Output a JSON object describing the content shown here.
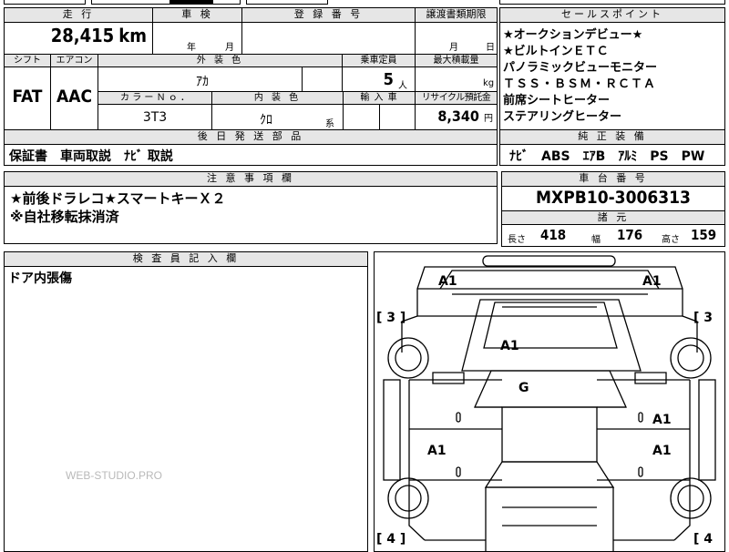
{
  "header": {
    "mileage_label": "走 行",
    "inspection_label": "車 検",
    "registration_label": "登 録 番 号",
    "transfer_label": "譲渡書類期限",
    "selling_points_label": "セールスポイント"
  },
  "mileage": {
    "value": "28,415",
    "unit": "km"
  },
  "inspection": {
    "year_unit": "年",
    "month_unit": "月"
  },
  "transfer": {
    "month_unit": "月",
    "day_unit": "日"
  },
  "shift": {
    "label": "シフト",
    "value": "FAT"
  },
  "aircon": {
    "label": "エアコン",
    "value": "AAC"
  },
  "exterior_color": {
    "label": "外 装 色",
    "value": "ｱｶ"
  },
  "capacity": {
    "label": "乗車定員",
    "value": "5",
    "unit": "人"
  },
  "max_load": {
    "label": "最大積載量",
    "unit": "kg"
  },
  "color_no": {
    "label": "カ ラ ー Ｎ ｏ ．",
    "value": "3T3"
  },
  "interior_color": {
    "label": "内 装 色",
    "value": "ｸﾛ",
    "suffix": "系"
  },
  "import": {
    "label": "輸 入 車"
  },
  "recycle": {
    "label": "リサイクル預託金",
    "value": "8,340",
    "unit": "円"
  },
  "selling_points": [
    "★オークションデビュー★",
    "★ビルトインＥＴＣ",
    "パノラミックビューモニター",
    "ＴＳＳ・ＢＳＭ・ＲＣＴＡ",
    "前席シートヒーター",
    "ステアリングヒーター"
  ],
  "later_parts": {
    "label": "後 日 発 送 部 品",
    "value": "保証書　車両取説　ﾅﾋﾞ 取説"
  },
  "genuine_equipment": {
    "label": "純 正 装 備",
    "value": "ﾅﾋﾞ　ABS　ｴｱB　ｱﾙﾐ　PS　PW"
  },
  "notes": {
    "label": "注 意 事 項 欄",
    "lines": [
      "★前後ドラレコ★スマートキーＸ２",
      "※自社移転抹消済"
    ]
  },
  "chassis": {
    "label": "車 台 番 号",
    "value": "MXPB10-3006313"
  },
  "specs": {
    "label": "諸 元",
    "length_label": "長さ",
    "length": "418",
    "width_label": "幅",
    "width": "176",
    "height_label": "高さ",
    "height": "159"
  },
  "inspector": {
    "label": "検 査 員 記 入 欄",
    "note": "ドア内張傷"
  },
  "diagram": {
    "marks": {
      "a1_front_left": "A1",
      "a1_front_right": "A1",
      "a1_hood": "A1",
      "g_windshield": "G",
      "a1_door_right_front": "A1",
      "a1_door_left_rear": "A1",
      "a1_door_right_rear": "A1",
      "tire_front_left": "[ 3 ]",
      "tire_front_right": "[ 3",
      "tire_rear_left": "[ 4 ]",
      "tire_rear_right": "[ 4"
    }
  },
  "watermark": "WEB-STUDIO.PRO"
}
